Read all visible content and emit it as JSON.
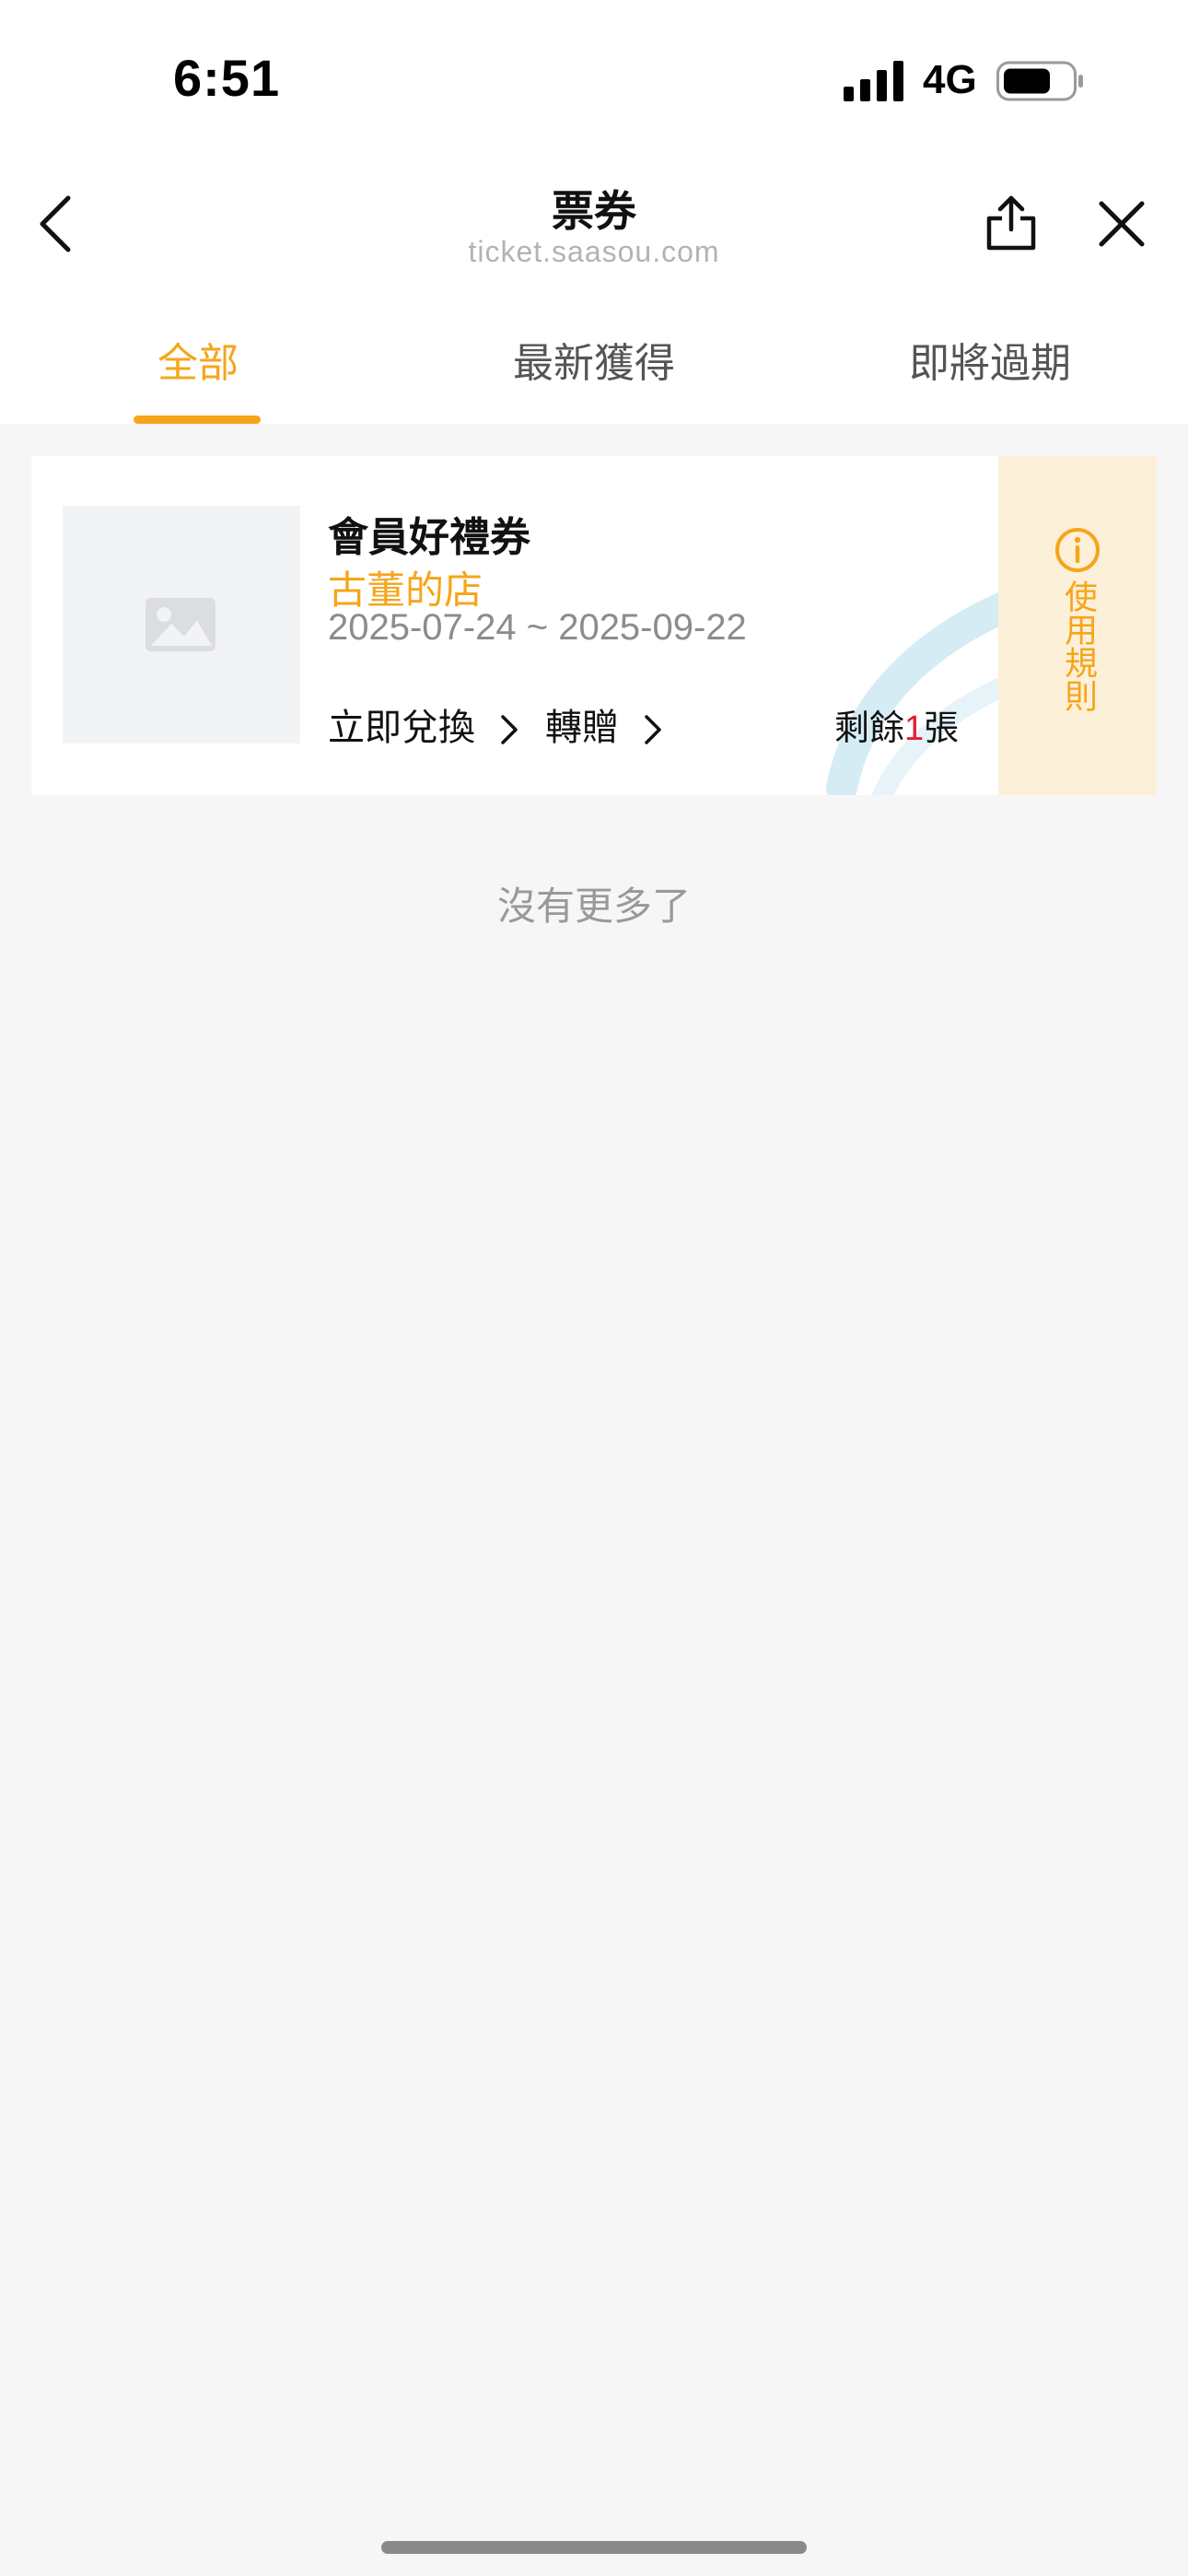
{
  "status_bar": {
    "time": "6:51",
    "network": "4G"
  },
  "header": {
    "title": "票券",
    "subtitle": "ticket.saasou.com"
  },
  "tabs": [
    {
      "label": "全部",
      "active": true
    },
    {
      "label": "最新獲得",
      "active": false
    },
    {
      "label": "即將過期",
      "active": false
    }
  ],
  "coupon": {
    "title": "會員好禮券",
    "store": "古董的店",
    "validity": "2025-07-24 ~ 2025-09-22",
    "redeem_label": "立即兌換",
    "gift_label": "轉贈",
    "remaining_prefix": "剩餘",
    "remaining_count": "1",
    "remaining_suffix": "張",
    "rules_label": "使用規則"
  },
  "footer_text": "沒有更多了",
  "colors": {
    "accent": "#f6a51a",
    "count_red": "#e0202f",
    "rules_bg": "#fdf0d9",
    "page_bg": "#f6f6f6"
  }
}
